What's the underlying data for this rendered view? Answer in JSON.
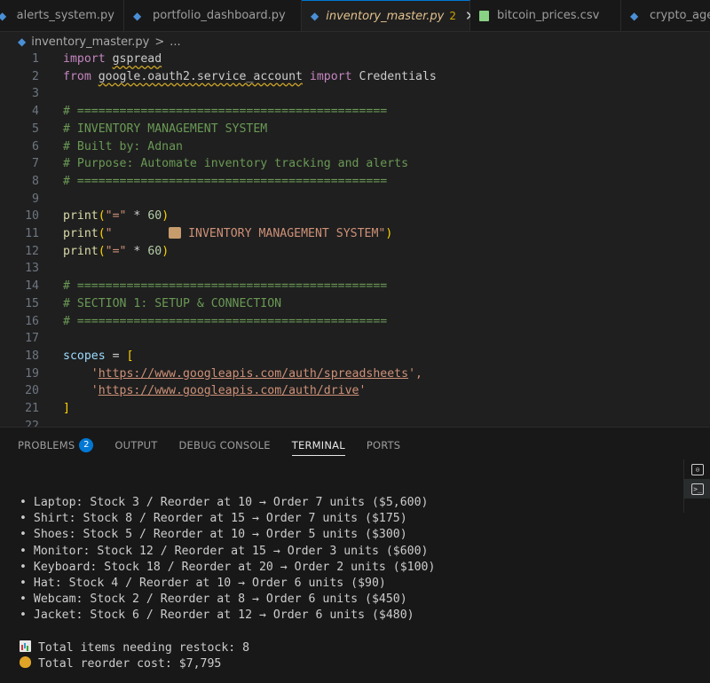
{
  "tabs": [
    {
      "label": "alerts_system.py",
      "icon": "python-icon"
    },
    {
      "label": "portfolio_dashboard.py",
      "icon": "python-icon"
    },
    {
      "label": "inventory_master.py",
      "icon": "python-icon",
      "active": true,
      "problems": "2"
    },
    {
      "label": "bitcoin_prices.csv",
      "icon": "csv-icon"
    },
    {
      "label": "crypto_agent",
      "icon": "python-icon"
    }
  ],
  "breadcrumb": {
    "file": "inventory_master.py",
    "separator": ">",
    "rest": "..."
  },
  "code": {
    "line_numbers": [
      "1",
      "2",
      "3",
      "4",
      "5",
      "6",
      "7",
      "8",
      "9",
      "10",
      "11",
      "12",
      "13",
      "14",
      "15",
      "16",
      "17",
      "18",
      "19",
      "20",
      "21",
      "22"
    ],
    "l1_import": "import",
    "l1_module": "gspread",
    "l2_from": "from",
    "l2_module": "google.oauth2.service_account",
    "l2_import": "import",
    "l2_name": "Credentials",
    "l4": "# ============================================",
    "l5": "# INVENTORY MANAGEMENT SYSTEM",
    "l6": "# Built by: Adnan",
    "l7": "# Purpose: Automate inventory tracking and alerts",
    "l8": "# ============================================",
    "l10_fn": "print",
    "l10_str": "\"=\"",
    "l10_op": " * ",
    "l10_num": "60",
    "l11_fn": "print",
    "l11_str_a": "\"        ",
    "l11_str_b": " INVENTORY MANAGEMENT SYSTEM\"",
    "l12_fn": "print",
    "l12_str": "\"=\"",
    "l12_op": " * ",
    "l12_num": "60",
    "l14": "# ============================================",
    "l15": "# SECTION 1: SETUP & CONNECTION",
    "l16": "# ============================================",
    "l18_var": "scopes",
    "l18_op": " = ",
    "l18_br": "[",
    "l19_q1": "'",
    "l19_url": "https://www.googleapis.com/auth/spreadsheets",
    "l19_q2": "',",
    "l20_q1": "'",
    "l20_url": "https://www.googleapis.com/auth/drive",
    "l20_q2": "'",
    "l21_br": "]"
  },
  "panel": {
    "tabs": [
      "PROBLEMS",
      "OUTPUT",
      "DEBUG CONSOLE",
      "TERMINAL",
      "PORTS"
    ],
    "problems_count": "2",
    "active_tab": "TERMINAL"
  },
  "terminal": {
    "lines": [
      "• Laptop: Stock 3 / Reorder at 10 → Order 7 units ($5,600)",
      "• Shirt: Stock 8 / Reorder at 15 → Order 7 units ($175)",
      "• Shoes: Stock 5 / Reorder at 10 → Order 5 units ($300)",
      "• Monitor: Stock 12 / Reorder at 15 → Order 3 units ($600)",
      "• Keyboard: Stock 18 / Reorder at 20 → Order 2 units ($100)",
      "• Hat: Stock 4 / Reorder at 10 → Order 6 units ($90)",
      "• Webcam: Stock 2 / Reorder at 8 → Order 6 units ($450)",
      "• Jacket: Stock 6 / Reorder at 12 → Order 6 units ($480)"
    ],
    "total_items": " Total items needing restock: 8",
    "total_cost": " Total reorder cost: $7,795"
  },
  "side_icons": [
    "copilot-icon",
    "terminal-icon"
  ]
}
